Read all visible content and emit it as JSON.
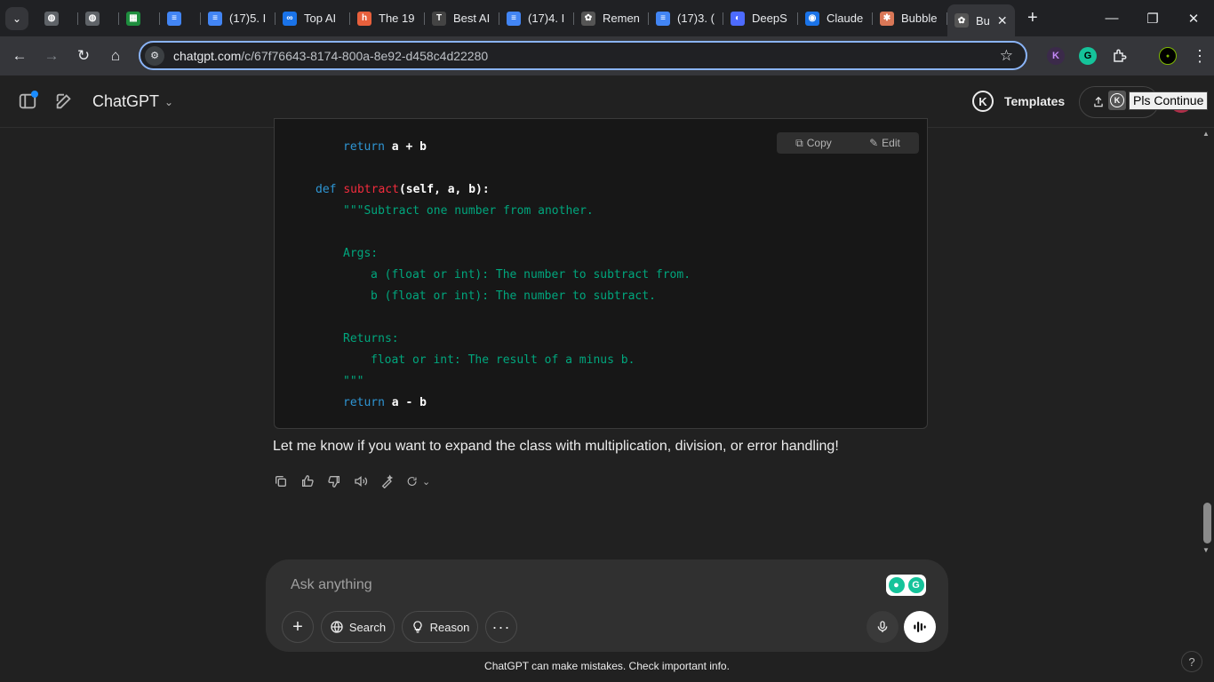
{
  "browser": {
    "tabs": [
      {
        "label": "",
        "icon": "globe-icon",
        "color": "#5f6368"
      },
      {
        "label": "",
        "icon": "globe-icon",
        "color": "#5f6368"
      },
      {
        "label": "",
        "icon": "sheets-icon",
        "color": "#1e8e3e"
      },
      {
        "label": "",
        "icon": "docs-icon",
        "color": "#4285f4"
      },
      {
        "label": "(17)5. I",
        "icon": "docs-icon",
        "color": "#4285f4"
      },
      {
        "label": "Top AI",
        "icon": "loop-icon",
        "color": "#1a73e8"
      },
      {
        "label": "The 19",
        "icon": "hackernoon-icon",
        "color": "#e8603c"
      },
      {
        "label": "Best AI",
        "icon": "t-icon",
        "color": "#444"
      },
      {
        "label": "(17)4. I",
        "icon": "docs-icon",
        "color": "#4285f4"
      },
      {
        "label": "Remen",
        "icon": "openai-icon",
        "color": "#555"
      },
      {
        "label": "(17)3. (",
        "icon": "docs-icon",
        "color": "#4285f4"
      },
      {
        "label": "DeepS",
        "icon": "deepseek-icon",
        "color": "#4d6bfe"
      },
      {
        "label": "Claude",
        "icon": "claude-icon",
        "color": "#1a73e8"
      },
      {
        "label": "Bubble",
        "icon": "asterisk-icon",
        "color": "#d97757"
      },
      {
        "label": "Bu",
        "icon": "openai-icon",
        "color": "#555",
        "active": true
      }
    ],
    "url_host": "chatgpt.com",
    "url_path": "/c/67f76643-8174-800a-8e92-d458c4d22280"
  },
  "header": {
    "app_name": "ChatGPT",
    "templates_label": "Templates",
    "tooltip": "Pls Continue"
  },
  "code": {
    "copy_label": "Copy",
    "edit_label": "Edit",
    "lines": [
      "return a + b",
      "def subtract(self, a, b):",
      "\"\"\"Subtract one number from another.",
      "Args:",
      "a (float or int): The number to subtract from.",
      "b (float or int): The number to subtract.",
      "Returns:",
      "float or int: The result of a minus b.",
      "\"\"\"",
      "return a - b"
    ]
  },
  "message": {
    "text": "Let me know if you want to expand the class with multiplication, division, or error handling!"
  },
  "composer": {
    "placeholder": "Ask anything",
    "search_label": "Search",
    "reason_label": "Reason"
  },
  "footer": {
    "disclaimer": "ChatGPT can make mistakes. Check important info.",
    "help": "?"
  }
}
